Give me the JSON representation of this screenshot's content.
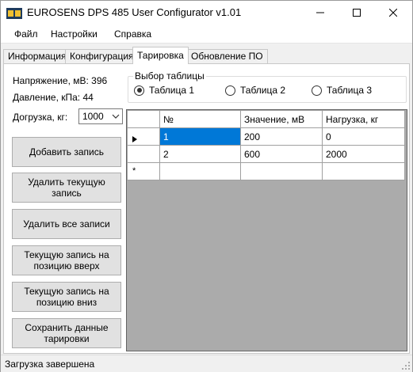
{
  "window": {
    "title": "EUROSENS DPS 485 User Configurator v1.01",
    "controls": {
      "minimize": "minimize-icon",
      "maximize": "maximize-icon",
      "close": "close-icon"
    }
  },
  "menu": [
    "Файл",
    "Настройки",
    "Справка"
  ],
  "tabs": [
    "Информация",
    "Конфигурация",
    "Тарировка",
    "Обновление ПО"
  ],
  "active_tab": "Тарировка",
  "info": {
    "voltage": "Напряжение, мВ: 396",
    "pressure": "Давление, кПа: 44",
    "load_label": "Догрузка, кг:",
    "load_value": "1000"
  },
  "buttons": {
    "add": "Добавить запись",
    "delete_current": "Удалить текущую запись",
    "delete_all": "Удалить все записи",
    "move_up": "Текущую запись на позицию вверх",
    "move_down": "Текущую запись на позицию вниз",
    "save": "Сохранить данные тарировки"
  },
  "table_select": {
    "title": "Выбор таблицы",
    "options": [
      "Таблица 1",
      "Таблица 2",
      "Таблица 3"
    ],
    "selected": "Таблица 1"
  },
  "grid": {
    "columns": [
      "№",
      "Значение, мВ",
      "Нагрузка, кг"
    ],
    "rows": [
      [
        "1",
        "200",
        "0"
      ],
      [
        "2",
        "600",
        "2000"
      ]
    ],
    "current_row_marker": "▶",
    "new_row_marker": "*"
  },
  "status": "Загрузка завершена",
  "colors": {
    "selection": "#0078d7",
    "grid_background": "#ababab"
  }
}
